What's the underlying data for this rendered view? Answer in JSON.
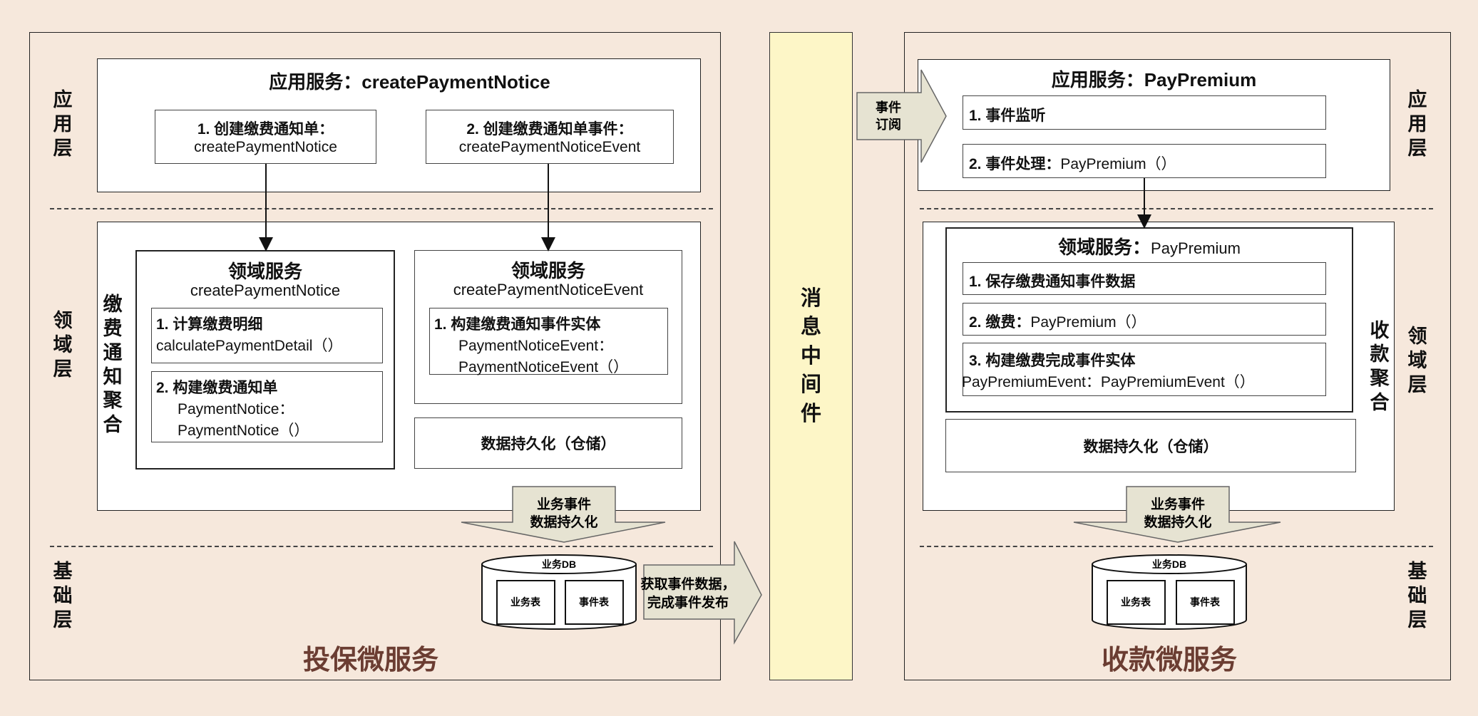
{
  "left": {
    "layers": {
      "app": "应用层",
      "domain": "领域层",
      "infra": "基础层"
    },
    "app_service_title": "应用服务：createPaymentNotice",
    "step1_title": "1. 创建缴费通知单：",
    "step1_code": "createPaymentNotice",
    "step2_title": "2. 创建缴费通知单事件：",
    "step2_code": "createPaymentNoticeEvent",
    "aggregate_label": "缴费通知聚合",
    "ds1_title": "领域服务",
    "ds1_code": "createPaymentNotice",
    "ds1_item1_title": "1. 计算缴费明细",
    "ds1_item1_code": "calculatePaymentDetail（）",
    "ds1_item2_title": "2. 构建缴费通知单",
    "ds1_item2_code1": "PaymentNotice：",
    "ds1_item2_code2": "PaymentNotice（）",
    "ds2_title": "领域服务",
    "ds2_code": "createPaymentNoticeEvent",
    "ds2_item1_title": "1. 构建缴费通知事件实体",
    "ds2_item1_code1": "PaymentNoticeEvent：",
    "ds2_item1_code2": "PaymentNoticeEvent（）",
    "persistence": "数据持久化（仓储）",
    "event_persist_1": "业务事件",
    "event_persist_2": "数据持久化",
    "db_title": "业务DB",
    "db_table1": "业务表",
    "db_table2": "事件表",
    "publish_1": "获取事件数据，",
    "publish_2": "完成事件发布",
    "footer": "投保微服务"
  },
  "middleware": {
    "label": "消息中间件",
    "subscribe_1": "事件",
    "subscribe_2": "订阅"
  },
  "right": {
    "layers": {
      "app": "应用层",
      "domain": "领域层",
      "infra": "基础层"
    },
    "app_service_title": "应用服务：PayPremium",
    "step1": "1. 事件监听",
    "step2_title": "2. 事件处理：",
    "step2_code": "PayPremium（）",
    "aggregate_label": "收款聚合",
    "ds_title": "领域服务：",
    "ds_code": "PayPremium",
    "ds_item1": "1. 保存缴费通知事件数据",
    "ds_item2_title": "2. 缴费：",
    "ds_item2_code": "PayPremium（）",
    "ds_item3_title": "3. 构建缴费完成事件实体",
    "ds_item3_code": "PayPremiumEvent：PayPremiumEvent（）",
    "persistence": "数据持久化（仓储）",
    "event_persist_1": "业务事件",
    "event_persist_2": "数据持久化",
    "db_title": "业务DB",
    "db_table1": "业务表",
    "db_table2": "事件表",
    "footer": "收款微服务"
  }
}
